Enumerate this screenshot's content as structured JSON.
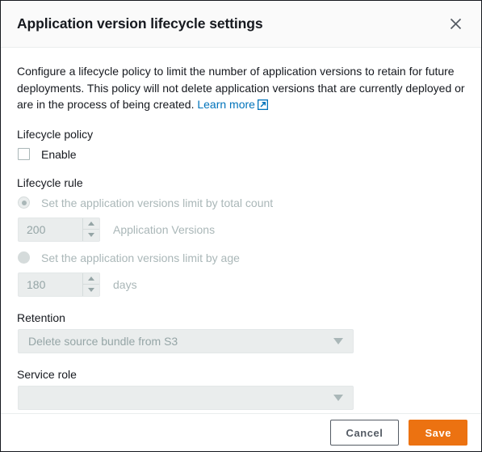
{
  "dialog": {
    "title": "Application version lifecycle settings",
    "close_icon": "close-icon",
    "description_part1": "Configure a lifecycle policy to limit the number of application versions to retain for future deployments. This policy will not delete application versions that are currently deployed or are in the process of being created. ",
    "learn_more_label": "Learn more",
    "external_link_icon": "external-link-icon"
  },
  "lifecycle_policy": {
    "label": "Lifecycle policy",
    "enable_label": "Enable",
    "enable_checked": false
  },
  "lifecycle_rule": {
    "label": "Lifecycle rule",
    "options": [
      {
        "label": "Set the application versions limit by total count",
        "selected": true,
        "disabled": true,
        "input_value": "200",
        "unit": "Application Versions"
      },
      {
        "label": "Set the application versions limit by age",
        "selected": false,
        "disabled": true,
        "input_value": "180",
        "unit": "days"
      }
    ]
  },
  "retention": {
    "label": "Retention",
    "selected_value": "Delete source bundle from S3",
    "disabled": true
  },
  "service_role": {
    "label": "Service role",
    "selected_value": "",
    "disabled": true
  },
  "footer": {
    "cancel_label": "Cancel",
    "save_label": "Save"
  },
  "colors": {
    "accent_orange": "#ec7211",
    "link_blue": "#0073bb",
    "disabled_grey": "#aab7b8",
    "field_bg": "#eaeded",
    "text_dark": "#16191f"
  }
}
